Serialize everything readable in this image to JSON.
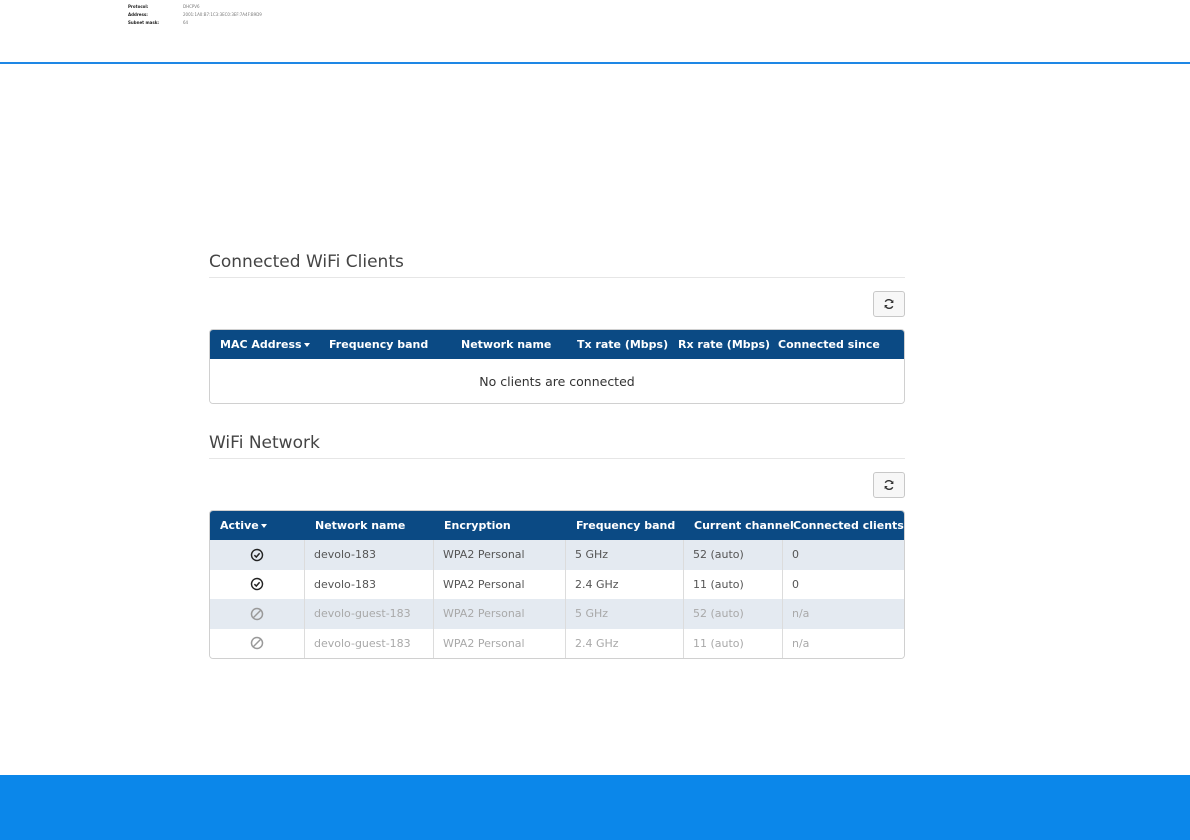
{
  "top_info": [
    {
      "key": "Protocol:",
      "value": "DHCPV6"
    },
    {
      "key": "Address:",
      "value": "2001:1A0:B7:1C3:3EC0:3EF:7A4F:B9D9"
    },
    {
      "key": "Subnet mask:",
      "value": "64"
    }
  ],
  "clients": {
    "title": "Connected WiFi Clients",
    "columns": [
      "MAC Address",
      "Frequency band",
      "Network name",
      "Tx rate (Mbps)",
      "Rx rate (Mbps)",
      "Connected since"
    ],
    "empty_message": "No clients are connected"
  },
  "wifi": {
    "title": "WiFi Network",
    "columns": [
      "Active",
      "Network name",
      "Encryption",
      "Frequency band",
      "Current channel",
      "Connected clients"
    ],
    "rows": [
      {
        "active": "check-circle-icon",
        "network": "devolo-183",
        "encryption": "WPA2 Personal",
        "band": "5 GHz",
        "channel": "52 (auto)",
        "clients": "0"
      },
      {
        "active": "check-circle-icon",
        "network": "devolo-183",
        "encryption": "WPA2 Personal",
        "band": "2.4 GHz",
        "channel": "11 (auto)",
        "clients": "0"
      },
      {
        "active": "disabled-icon",
        "network": "devolo-guest-183",
        "encryption": "WPA2 Personal",
        "band": "5 GHz",
        "channel": "52 (auto)",
        "clients": "n/a"
      },
      {
        "active": "disabled-icon",
        "network": "devolo-guest-183",
        "encryption": "WPA2 Personal",
        "band": "2.4 GHz",
        "channel": "11 (auto)",
        "clients": "n/a"
      }
    ]
  },
  "colors": {
    "header_bg": "#0b4a84",
    "accent": "#1e87e5",
    "footer": "#0b87ea",
    "row_shaded": "#e4eaf1"
  }
}
